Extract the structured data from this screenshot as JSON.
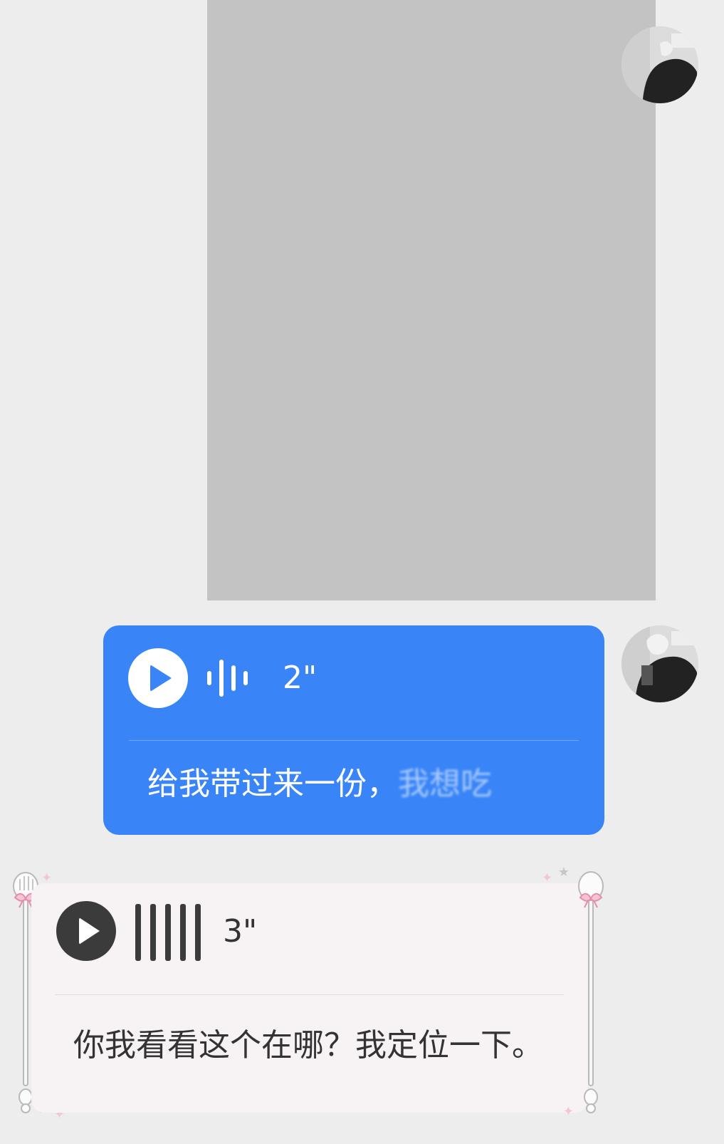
{
  "messages": [
    {
      "type": "image",
      "direction": "outgoing"
    },
    {
      "type": "voice",
      "direction": "outgoing",
      "duration": "2\"",
      "transcript_visible": "给我带过来一份，",
      "transcript_faded": "我想吃"
    },
    {
      "type": "voice",
      "direction": "incoming",
      "duration": "3\"",
      "transcript": "你我看看这个在哪？我定位一下。"
    }
  ],
  "colors": {
    "background": "#ededed",
    "outgoing_bubble": "#3985f7",
    "incoming_bubble": "#f7f2f4",
    "image_placeholder": "#c3c3c3",
    "play_icon_dark": "#3b3b3b"
  },
  "icons": {
    "outgoing_play": "play-icon",
    "outgoing_wave": "voice-wave-icon",
    "incoming_play": "play-icon",
    "incoming_wave": "voice-bars-icon",
    "decoration": "spoon-ribbon-decoration"
  }
}
